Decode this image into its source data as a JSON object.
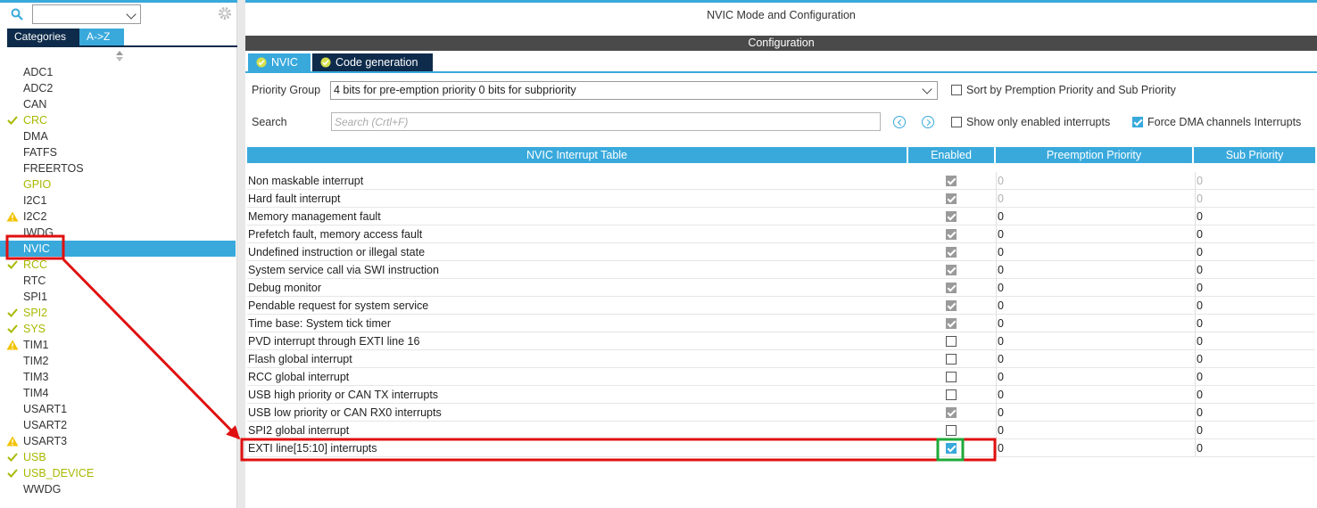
{
  "left_panel": {
    "search_value": "",
    "tabs": [
      {
        "label": "Categories"
      },
      {
        "label": "A->Z"
      }
    ],
    "peripherals": [
      {
        "label": "ADC1",
        "status": "none"
      },
      {
        "label": "ADC2",
        "status": "none"
      },
      {
        "label": "CAN",
        "status": "none"
      },
      {
        "label": "CRC",
        "status": "ok"
      },
      {
        "label": "DMA",
        "status": "none"
      },
      {
        "label": "FATFS",
        "status": "none"
      },
      {
        "label": "FREERTOS",
        "status": "none"
      },
      {
        "label": "GPIO",
        "status": "ok-nocheck"
      },
      {
        "label": "I2C1",
        "status": "none"
      },
      {
        "label": "I2C2",
        "status": "warn"
      },
      {
        "label": "IWDG",
        "status": "none"
      },
      {
        "label": "NVIC",
        "status": "selected"
      },
      {
        "label": "RCC",
        "status": "ok"
      },
      {
        "label": "RTC",
        "status": "none"
      },
      {
        "label": "SPI1",
        "status": "none"
      },
      {
        "label": "SPI2",
        "status": "ok"
      },
      {
        "label": "SYS",
        "status": "ok"
      },
      {
        "label": "TIM1",
        "status": "warn"
      },
      {
        "label": "TIM2",
        "status": "none"
      },
      {
        "label": "TIM3",
        "status": "none"
      },
      {
        "label": "TIM4",
        "status": "none"
      },
      {
        "label": "USART1",
        "status": "none"
      },
      {
        "label": "USART2",
        "status": "none"
      },
      {
        "label": "USART3",
        "status": "warn"
      },
      {
        "label": "USB",
        "status": "ok"
      },
      {
        "label": "USB_DEVICE",
        "status": "ok"
      },
      {
        "label": "WWDG",
        "status": "none"
      }
    ]
  },
  "right_panel": {
    "title": "NVIC Mode and Configuration",
    "section_title": "Configuration",
    "tabs": [
      {
        "label": "NVIC"
      },
      {
        "label": "Code generation"
      }
    ],
    "priority_group": {
      "label": "Priority Group",
      "value": "4 bits for pre-emption priority 0 bits for subpriority"
    },
    "search": {
      "label": "Search",
      "placeholder": "Search (Crtl+F)"
    },
    "options": {
      "sort_label": "Sort by Premption Priority and Sub Priority",
      "sort_checked": false,
      "show_enabled_label": "Show only enabled interrupts",
      "show_enabled_checked": false,
      "force_dma_label": "Force DMA channels Interrupts",
      "force_dma_checked": true
    },
    "table": {
      "headers": {
        "name": "NVIC Interrupt Table",
        "enabled": "Enabled",
        "preemption": "Preemption Priority",
        "sub": "Sub Priority"
      },
      "rows": [
        {
          "name": "Non maskable interrupt",
          "enabled": "forced",
          "pre": "0",
          "sub": "0",
          "disabled": true
        },
        {
          "name": "Hard fault interrupt",
          "enabled": "forced",
          "pre": "0",
          "sub": "0",
          "disabled": true
        },
        {
          "name": "Memory management fault",
          "enabled": "forced",
          "pre": "0",
          "sub": "0",
          "disabled": false
        },
        {
          "name": "Prefetch fault, memory access fault",
          "enabled": "forced",
          "pre": "0",
          "sub": "0",
          "disabled": false
        },
        {
          "name": "Undefined instruction or illegal state",
          "enabled": "forced",
          "pre": "0",
          "sub": "0",
          "disabled": false
        },
        {
          "name": "System service call via SWI instruction",
          "enabled": "forced",
          "pre": "0",
          "sub": "0",
          "disabled": false
        },
        {
          "name": "Debug monitor",
          "enabled": "forced",
          "pre": "0",
          "sub": "0",
          "disabled": false
        },
        {
          "name": "Pendable request for system service",
          "enabled": "forced",
          "pre": "0",
          "sub": "0",
          "disabled": false
        },
        {
          "name": "Time base: System tick timer",
          "enabled": "forced",
          "pre": "0",
          "sub": "0",
          "disabled": false
        },
        {
          "name": "PVD interrupt through EXTI line 16",
          "enabled": "off",
          "pre": "0",
          "sub": "0",
          "disabled": false
        },
        {
          "name": "Flash global interrupt",
          "enabled": "off",
          "pre": "0",
          "sub": "0",
          "disabled": false
        },
        {
          "name": "RCC global interrupt",
          "enabled": "off",
          "pre": "0",
          "sub": "0",
          "disabled": false
        },
        {
          "name": "USB high priority or CAN TX interrupts",
          "enabled": "off",
          "pre": "0",
          "sub": "0",
          "disabled": false
        },
        {
          "name": "USB low priority or CAN RX0 interrupts",
          "enabled": "forced",
          "pre": "0",
          "sub": "0",
          "disabled": false
        },
        {
          "name": "SPI2 global interrupt",
          "enabled": "off",
          "pre": "0",
          "sub": "0",
          "disabled": false
        },
        {
          "name": "EXTI line[15:10] interrupts",
          "enabled": "on",
          "pre": "0",
          "sub": "0",
          "disabled": false
        }
      ]
    }
  },
  "colors": {
    "accent": "#39a9dc",
    "dark_tab": "#0e2b4b",
    "ok_yellow": "#a8b800",
    "warn_yellow": "#f2c200",
    "annotation_red": "#e01010",
    "annotation_green": "#1fa83a"
  }
}
